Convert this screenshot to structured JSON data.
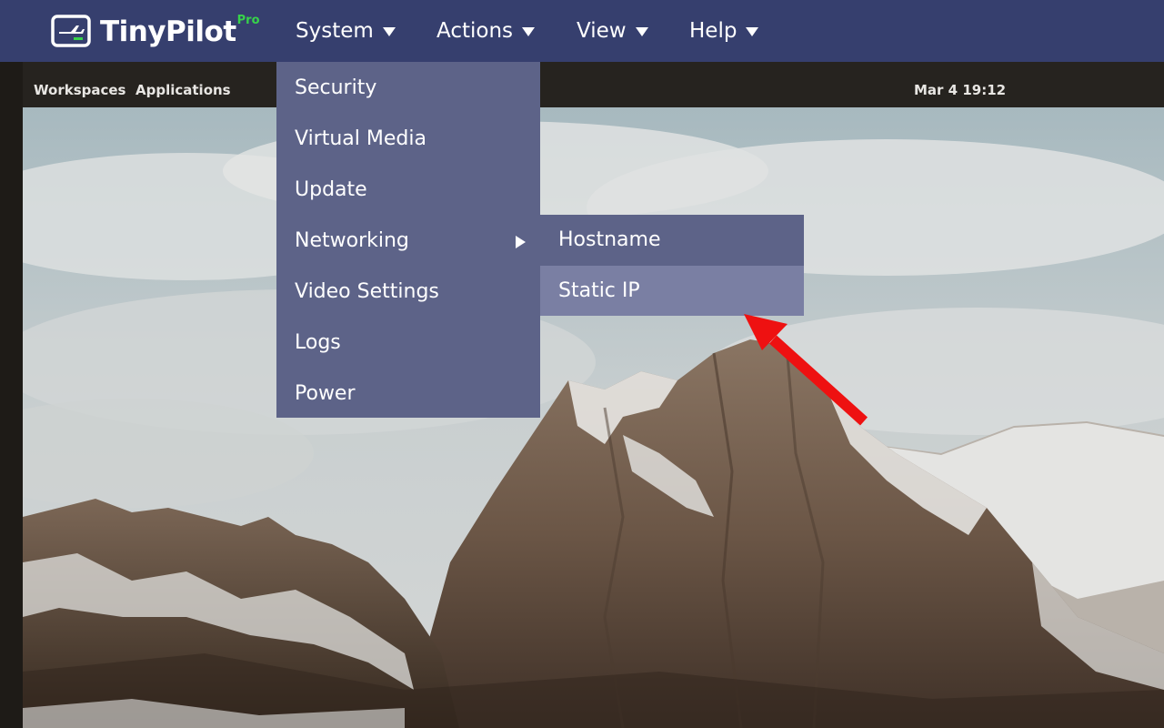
{
  "app": {
    "name": "TinyPilot",
    "edition": "Pro"
  },
  "navbar": {
    "menus": [
      {
        "label": "System"
      },
      {
        "label": "Actions"
      },
      {
        "label": "View"
      },
      {
        "label": "Help"
      }
    ]
  },
  "system_menu": {
    "items": [
      {
        "label": "Security"
      },
      {
        "label": "Virtual Media"
      },
      {
        "label": "Update"
      },
      {
        "label": "Networking",
        "has_submenu": true
      },
      {
        "label": "Video Settings"
      },
      {
        "label": "Logs"
      },
      {
        "label": "Power"
      }
    ]
  },
  "networking_submenu": {
    "items": [
      {
        "label": "Hostname"
      },
      {
        "label": "Static IP",
        "highlighted": true
      }
    ]
  },
  "remote_desktop": {
    "topbar": {
      "workspaces": "Workspaces",
      "applications": "Applications",
      "clock": "Mar 4  19:12"
    }
  },
  "colors": {
    "navbar": "#363f6e",
    "menu": "#5d6388",
    "menu_highlight": "#7a7fa3",
    "pro_badge": "#37d34a",
    "annotation_arrow": "#ee1111"
  },
  "icons": {
    "logo": "tinypilot-logo-icon",
    "caret": "caret-down-icon",
    "submenu": "caret-right-icon"
  }
}
